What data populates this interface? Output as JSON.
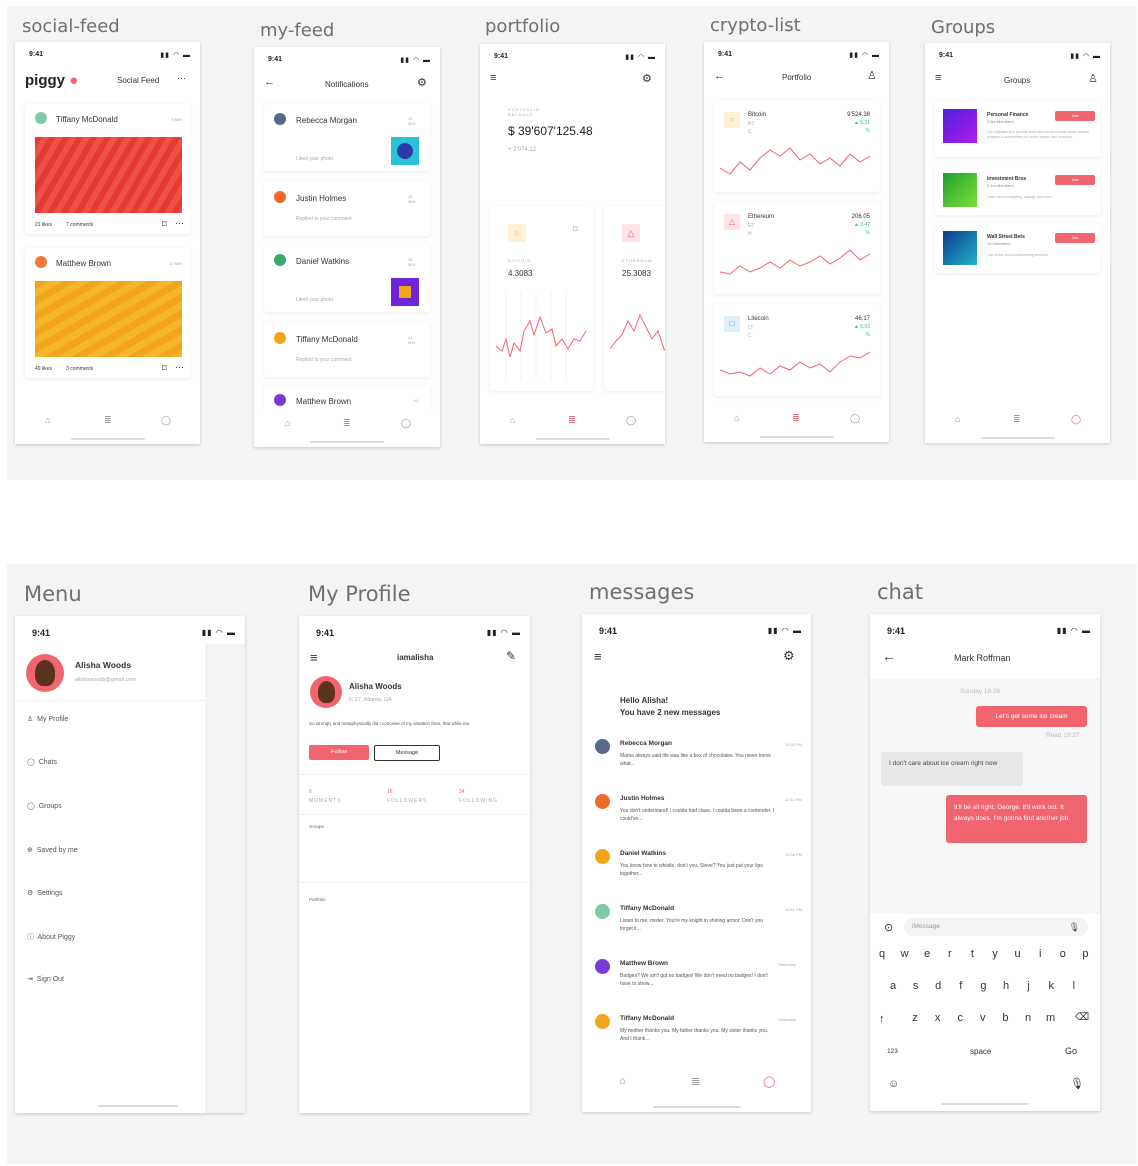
{
  "colors": {
    "accent": "#f0656e",
    "green": "#2fc57a",
    "bg_band": "#f4f4f5"
  },
  "labels": {
    "social_feed": "social-feed",
    "my_feed": "my-feed",
    "portfolio": "portfolio",
    "crypto_list": "crypto-list",
    "groups": "Groups",
    "menu": "Menu",
    "my_profile": "My Profile",
    "messages": "messages",
    "chat": "chat"
  },
  "status": {
    "time": "9:41"
  },
  "social": {
    "logo": "piggy",
    "title": "Social Feed",
    "more": "···",
    "posts": [
      {
        "name": "Tiffany McDonald",
        "time": "5 MIN",
        "likes": "21 likes",
        "comments": "7 comments"
      },
      {
        "name": "Matthew Brown",
        "time": "10 MIN",
        "likes": "49 likes",
        "comments": "3 comments"
      }
    ]
  },
  "notifications": {
    "title": "Notifications",
    "items": [
      {
        "name": "Rebecca Morgan",
        "action": "Liked your photo",
        "time": "12 MIN"
      },
      {
        "name": "Justin Holmes",
        "action": "Replied to your comment",
        "time": "26 MIN"
      },
      {
        "name": "Daniel Watkins",
        "action": "Liked your photo",
        "time": "28 MIN"
      },
      {
        "name": "Tiffany McDonald",
        "action": "Replied to your comment",
        "time": "31 MIN"
      },
      {
        "name": "Matthew Brown",
        "action": "",
        "time": "40"
      }
    ]
  },
  "portfolio": {
    "balance_label": "PORTFOLIO BALANCE",
    "balance": "$ 39'607'125.48",
    "change": "+ 2'074.12",
    "cards": [
      {
        "label": "BITCOIN",
        "value": "4.3083"
      },
      {
        "label": "ETHEREUM",
        "value": "25.3083"
      }
    ]
  },
  "crypto": {
    "title": "Portfolio",
    "coins": [
      {
        "name": "Bitcoin",
        "sym": "BT",
        "sub": "C",
        "price": "9'524.38",
        "delta": "5.31",
        "pct": "%"
      },
      {
        "name": "Ethereum",
        "sym": "ET",
        "sub": "H",
        "price": "206.05",
        "delta": "3.47",
        "pct": "%"
      },
      {
        "name": "Litecoin",
        "sym": "LT",
        "sub": "C",
        "price": "46.17",
        "delta": "6.93",
        "pct": "%"
      }
    ]
  },
  "groups": {
    "title": "Groups",
    "join": "Join",
    "items": [
      {
        "name": "Personal Finance",
        "members": "2.5m Members",
        "desc": "Our objective is to provide short and mid term trade ideas, market analysis & commentary for active traders and investors."
      },
      {
        "name": "Investment Bros",
        "members": "2.1m Members",
        "desc": "Learn about budgeting, savings and more."
      },
      {
        "name": "Wall Street Bets",
        "members": "1m Members",
        "desc": "Like 4chan found a bloomberg terminal."
      }
    ]
  },
  "menu": {
    "name": "Alisha Woods",
    "email": "alishawoods@gmail.com",
    "items": [
      "My Profile",
      "Chats",
      "Groups",
      "Saved by me",
      "Settings",
      "About Piggy",
      "Sign Out"
    ]
  },
  "profile": {
    "username": "iamalisha",
    "name": "Alisha Woods",
    "meta": "F, 27, Atlanta, GA",
    "bio": "So strongly and metaphysically did I conceive of my situation then, that while ear",
    "follow": "Follow",
    "message": "Message",
    "stats": [
      {
        "n": "6",
        "l": "MOMENTS"
      },
      {
        "n": "16",
        "l": "FOLLOWERS"
      },
      {
        "n": "34",
        "l": "FOLLOWING"
      }
    ],
    "groups_label": "Groups",
    "portfolio_label": "Portfolio"
  },
  "messages": {
    "greeting": "Hello Alisha!",
    "subtitle": "You have 2 new messages",
    "items": [
      {
        "name": "Rebecca Morgan",
        "text": "Mama always said life was like a box of chocolates. You never know what...",
        "time": "12:34 PM"
      },
      {
        "name": "Justin Holmes",
        "text": "You don't understand! I coulda had class. I coulda been a contender. I could've...",
        "time": "12:11 PM"
      },
      {
        "name": "Daniel Watkins",
        "text": "You know how to whistle, don't you, Steve? You just put your lips together...",
        "time": "12:08 PM"
      },
      {
        "name": "Tiffany McDonald",
        "text": "Listen to me, mister. You're my knight in shining armor. Don't you forget it...",
        "time": "10:41 PM"
      },
      {
        "name": "Matthew Brown",
        "text": "Badges? We ain't got no badges! We don't need no badges! I don't have to show...",
        "time": "Yesterday"
      },
      {
        "name": "Tiffany McDonald",
        "text": "My mother thanks you. My father thanks you. My sister thanks you. And I thank...",
        "time": "Yesterday"
      }
    ]
  },
  "chat": {
    "contact": "Mark Roffman",
    "date": "Sunday 19:26",
    "read": "Read 19:27",
    "messages": [
      {
        "from": "me",
        "text": "Let's get some ice cream"
      },
      {
        "from": "them",
        "text": "I don't care about ice cream right now"
      },
      {
        "from": "me",
        "text": "It'll be all right, George. It'll work out. It always does. I'm gonna find another job."
      }
    ],
    "input_placeholder": "iMessage",
    "keys_row1": [
      "q",
      "w",
      "e",
      "r",
      "t",
      "y",
      "u",
      "i",
      "o",
      "p"
    ],
    "keys_row2": [
      "a",
      "s",
      "d",
      "f",
      "g",
      "h",
      "j",
      "k",
      "l"
    ],
    "keys_row3": [
      "z",
      "x",
      "c",
      "v",
      "b",
      "n",
      "m"
    ],
    "key_123": "123",
    "key_space": "space",
    "key_go": "Go"
  }
}
